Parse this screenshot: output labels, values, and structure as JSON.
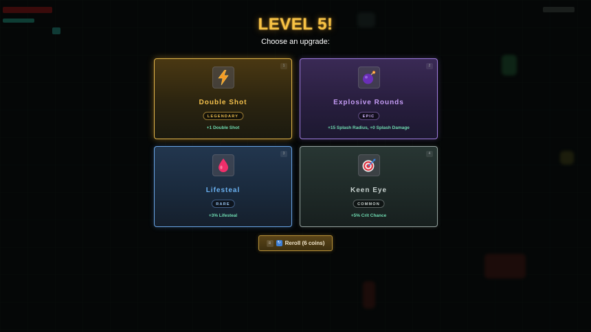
{
  "title": "LEVEL 5!",
  "subtitle": "Choose an upgrade:",
  "cards": [
    {
      "hotkey": "1",
      "name": "Double Shot",
      "rarity": "LEGENDARY",
      "effect": "+1 Double Shot",
      "icon": "lightning-icon",
      "accent": "#f4c14c"
    },
    {
      "hotkey": "2",
      "name": "Explosive Rounds",
      "rarity": "EPIC",
      "effect": "+15 Splash Radius, +0 Splash Damage",
      "icon": "bomb-icon",
      "accent": "#c59cf5"
    },
    {
      "hotkey": "3",
      "name": "Lifesteal",
      "rarity": "RARE",
      "effect": "+3% Lifesteal",
      "icon": "blood-drop-icon",
      "accent": "#6bb2f2"
    },
    {
      "hotkey": "4",
      "name": "Keen Eye",
      "rarity": "COMMON",
      "effect": "+5% Crit Chance",
      "icon": "target-icon",
      "accent": "#c8d2cf"
    }
  ],
  "reroll": {
    "hotkey": "R",
    "label": "Reroll (6 coins)",
    "icon": "reroll-icon"
  },
  "colors": {
    "title": "#f7c244",
    "effect_text": "#6fdcb1",
    "legendary": "#e6b84b",
    "epic": "#a07de0",
    "rare": "#6aa6e8",
    "common": "#95a3a0"
  }
}
